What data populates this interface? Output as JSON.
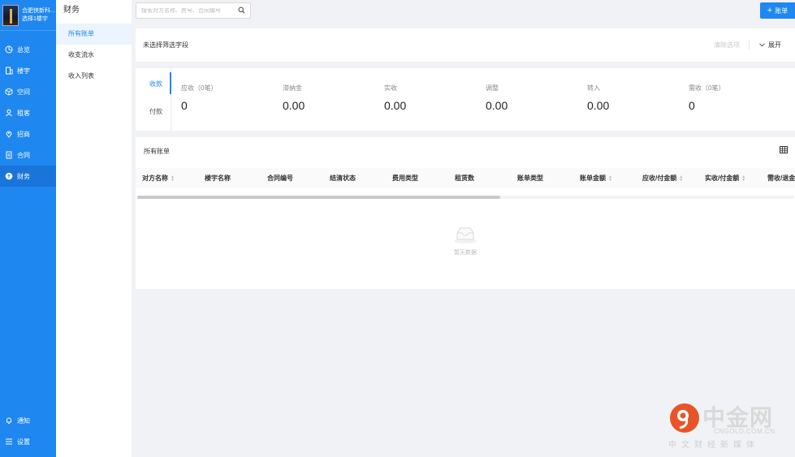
{
  "org": {
    "name": "合肥侠新科...",
    "building": "选择1楼宇"
  },
  "nav": {
    "items": [
      {
        "label": "总览",
        "icon": "dashboard-icon"
      },
      {
        "label": "楼宇",
        "icon": "building-icon"
      },
      {
        "label": "空间",
        "icon": "cube-icon"
      },
      {
        "label": "租客",
        "icon": "tenant-icon"
      },
      {
        "label": "招商",
        "icon": "location-icon"
      },
      {
        "label": "合同",
        "icon": "document-icon"
      },
      {
        "label": "财务",
        "icon": "finance-icon"
      }
    ],
    "active_index": 6,
    "bottom": [
      {
        "label": "通知",
        "icon": "bell-icon"
      },
      {
        "label": "设置",
        "icon": "menu-icon"
      }
    ]
  },
  "submenu": {
    "title": "财务",
    "items": [
      {
        "label": "所有账单"
      },
      {
        "label": "收支流水"
      },
      {
        "label": "收入列表"
      }
    ],
    "active_index": 0
  },
  "search": {
    "placeholder": "搜索对方名称、房号、合同编号",
    "value": ""
  },
  "toolbar": {
    "bill_button": "账单"
  },
  "filter": {
    "none_label": "未选择筛选字段",
    "clear_label": "清除选项",
    "expand_label": "展开"
  },
  "stats": {
    "tabs": [
      "收款",
      "付款"
    ],
    "active_tab": 0,
    "items": [
      {
        "label": "应收（0笔）",
        "value": "0"
      },
      {
        "label": "滞纳金",
        "value": "0.00"
      },
      {
        "label": "实收",
        "value": "0.00"
      },
      {
        "label": "调整",
        "value": "0.00"
      },
      {
        "label": "转入",
        "value": "0.00"
      },
      {
        "label": "需收（0笔）",
        "value": "0"
      }
    ]
  },
  "table": {
    "title": "所有账单",
    "columns": [
      {
        "label": "对方名称",
        "sortable": true
      },
      {
        "label": "楼宇名称",
        "sortable": false
      },
      {
        "label": "合同编号",
        "sortable": false
      },
      {
        "label": "结清状态",
        "sortable": false
      },
      {
        "label": "费用类型",
        "sortable": false
      },
      {
        "label": "租赁数",
        "sortable": false
      },
      {
        "label": "账单类型",
        "sortable": false
      },
      {
        "label": "账单金额",
        "sortable": true
      },
      {
        "label": "应收/付金额",
        "sortable": true
      },
      {
        "label": "实收/付金额",
        "sortable": true
      },
      {
        "label": "需收/退金额",
        "sortable": false
      }
    ],
    "empty_text": "暂无数据"
  },
  "watermark": {
    "name": "中金网",
    "url": "CNGOLD.COM.CN",
    "slogan": "中文财经新媒体"
  },
  "colors": {
    "primary": "#1f87f0",
    "nav_bg": "#1f87f0",
    "page_bg": "#f0f2f5"
  }
}
